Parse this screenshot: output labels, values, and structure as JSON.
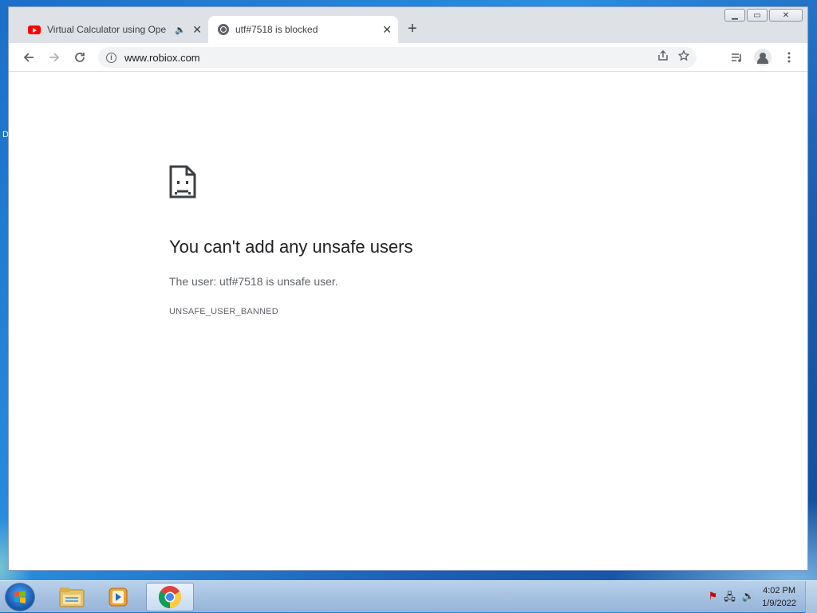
{
  "desktop": {
    "partial_label": "D"
  },
  "browser": {
    "tabs": [
      {
        "title": "Virtual Calculator using OpenCV",
        "active": false,
        "icon": "youtube-icon",
        "audio": true
      },
      {
        "title": "utf#7518 is blocked",
        "active": true,
        "icon": "globe-icon"
      }
    ],
    "new_tab_label": "+",
    "tab_close_glyph": "✕",
    "url": "www.robiox.com",
    "window_controls": {
      "minimize": "▁",
      "maximize": "▭",
      "close": "✕"
    }
  },
  "page": {
    "title": "You can't add any unsafe users",
    "description": "The user: utf#7518 is unsafe user.",
    "error_code": "UNSAFE_USER_BANNED"
  },
  "taskbar": {
    "apps": [
      {
        "name": "windows-explorer",
        "active": false
      },
      {
        "name": "media-player",
        "active": false
      },
      {
        "name": "chrome",
        "active": true
      }
    ],
    "clock": {
      "time": "4:02 PM",
      "date": "1/9/2022"
    }
  },
  "colors": {
    "accent": "#1a73e8",
    "tab_bg": "#dee1e6",
    "youtube_red": "#ff0000"
  }
}
